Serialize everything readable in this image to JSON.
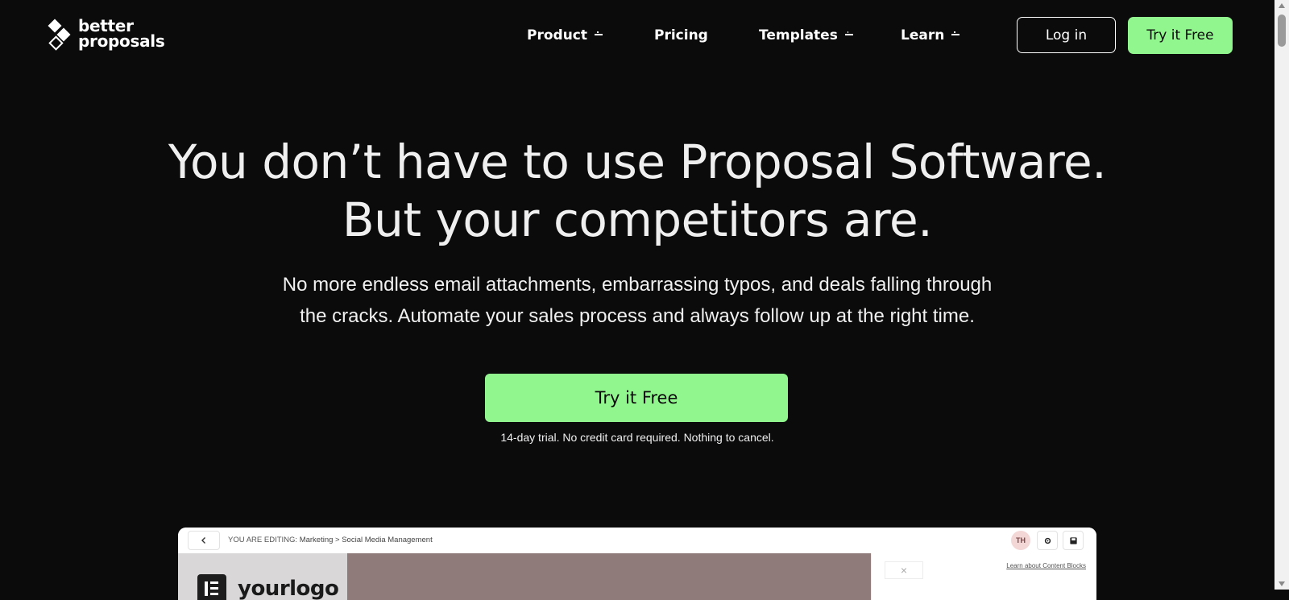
{
  "brand": {
    "logo_line1": "better",
    "logo_line2": "proposals"
  },
  "nav": {
    "items": [
      {
        "label": "Product",
        "has_dropdown": true
      },
      {
        "label": "Pricing",
        "has_dropdown": false
      },
      {
        "label": "Templates",
        "has_dropdown": true
      },
      {
        "label": "Learn",
        "has_dropdown": true
      }
    ],
    "login_label": "Log in",
    "try_label": "Try it Free"
  },
  "hero": {
    "title_line1": "You don’t have to use Proposal Software.",
    "title_line2": "But your competitors are.",
    "subtitle_line1": "No more endless email attachments, embarrassing typos, and deals falling through",
    "subtitle_line2": "the cracks. Automate your sales process and always follow up at the right time.",
    "cta_label": "Try it Free",
    "trial_note": "14-day trial. No credit card required. Nothing to cancel."
  },
  "preview": {
    "editing_prefix": "YOU ARE EDITING:",
    "editing_path": "Marketing > Social Media Management",
    "avatar_initials": "TH",
    "content_blocks_link": "Learn about Content Blocks",
    "close_symbol": "×",
    "logo_text": "yourlogo"
  },
  "colors": {
    "background": "#0b0b0c",
    "accent_green": "#92f68e",
    "text": "#f2f2f2"
  },
  "icons": {
    "back": "chevron-left-icon",
    "settings": "gear-icon",
    "save": "save-icon"
  }
}
